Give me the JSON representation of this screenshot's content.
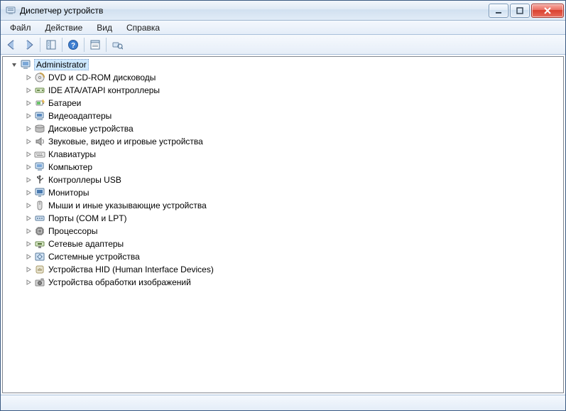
{
  "window": {
    "title": "Диспетчер устройств"
  },
  "menu": {
    "file": "Файл",
    "action": "Действие",
    "view": "Вид",
    "help": "Справка"
  },
  "tree": {
    "root": "Administrator",
    "items": [
      {
        "icon": "disc",
        "label": "DVD и CD-ROM дисководы"
      },
      {
        "icon": "ide",
        "label": "IDE ATA/ATAPI контроллеры"
      },
      {
        "icon": "battery",
        "label": "Батареи"
      },
      {
        "icon": "video",
        "label": "Видеоадаптеры"
      },
      {
        "icon": "disk",
        "label": "Дисковые устройства"
      },
      {
        "icon": "sound",
        "label": "Звуковые, видео и игровые устройства"
      },
      {
        "icon": "keyboard",
        "label": "Клавиатуры"
      },
      {
        "icon": "computer-small",
        "label": "Компьютер"
      },
      {
        "icon": "usb",
        "label": "Контроллеры USB"
      },
      {
        "icon": "monitor",
        "label": "Мониторы"
      },
      {
        "icon": "mouse",
        "label": "Мыши и иные указывающие устройства"
      },
      {
        "icon": "port",
        "label": "Порты (COM и LPT)"
      },
      {
        "icon": "cpu",
        "label": "Процессоры"
      },
      {
        "icon": "network",
        "label": "Сетевые адаптеры"
      },
      {
        "icon": "system",
        "label": "Системные устройства"
      },
      {
        "icon": "hid",
        "label": "Устройства HID (Human Interface Devices)"
      },
      {
        "icon": "imaging",
        "label": "Устройства обработки изображений"
      }
    ]
  }
}
